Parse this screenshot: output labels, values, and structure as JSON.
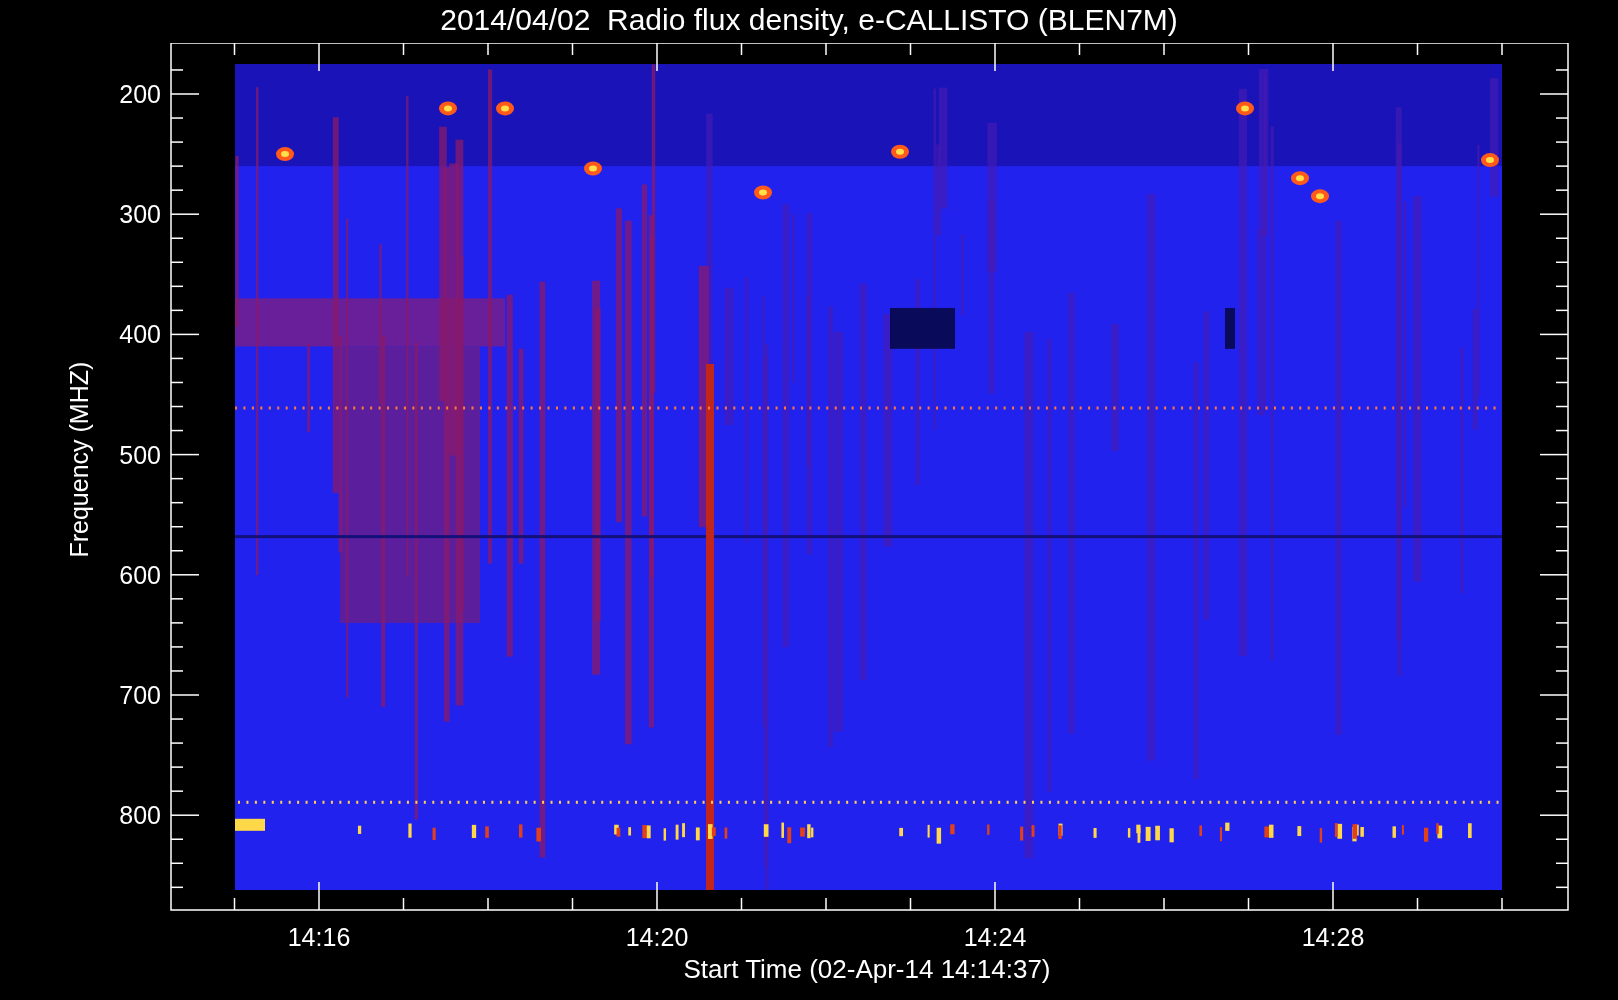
{
  "title": "2014/04/02  Radio flux density, e-CALLISTO (BLEN7M)",
  "y_axis": {
    "label": "Frequency (MHZ)",
    "ticks": [
      "200",
      "300",
      "400",
      "500",
      "600",
      "700",
      "800"
    ]
  },
  "x_axis": {
    "label": "Start Time (02-Apr-14 14:14:37)",
    "ticks": [
      "14:16",
      "14:20",
      "14:24",
      "14:28"
    ]
  }
}
